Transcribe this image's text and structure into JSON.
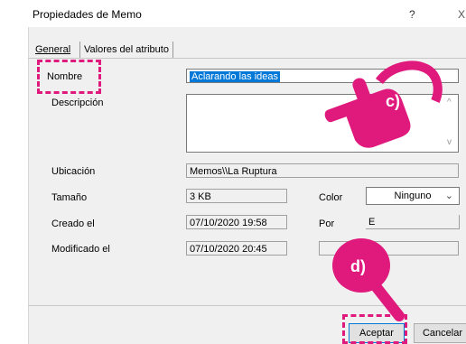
{
  "window": {
    "title": "Propiedades de Memo",
    "help": "?",
    "close": "X"
  },
  "tabs": [
    {
      "label": "General",
      "active": true
    },
    {
      "label": "Valores del atributo",
      "active": false
    }
  ],
  "form": {
    "nombre_label": "Nombre",
    "nombre_value": "Aclarando las ideas",
    "descripcion_label": "Descripción",
    "descripcion_value": "",
    "ubicacion_label": "Ubicación",
    "ubicacion_value": "Memos\\\\La Ruptura",
    "tamano_label": "Tamaño",
    "tamano_value": "3 KB",
    "color_label": "Color",
    "color_value": "Ninguno",
    "creado_label": "Creado el",
    "creado_value": "07/10/2020 19:58",
    "por_label": "Por",
    "por_value": "E",
    "modificado_label": "Modificado el",
    "modificado_value": "07/10/2020 20:45"
  },
  "buttons": {
    "accept": "Aceptar",
    "cancel": "Cancelar"
  },
  "annotations": {
    "c": "c)",
    "d": "d)"
  },
  "colors": {
    "annotation": "#e0197d",
    "selection": "#0078d7",
    "dialog_bg": "#f0f0f0"
  }
}
